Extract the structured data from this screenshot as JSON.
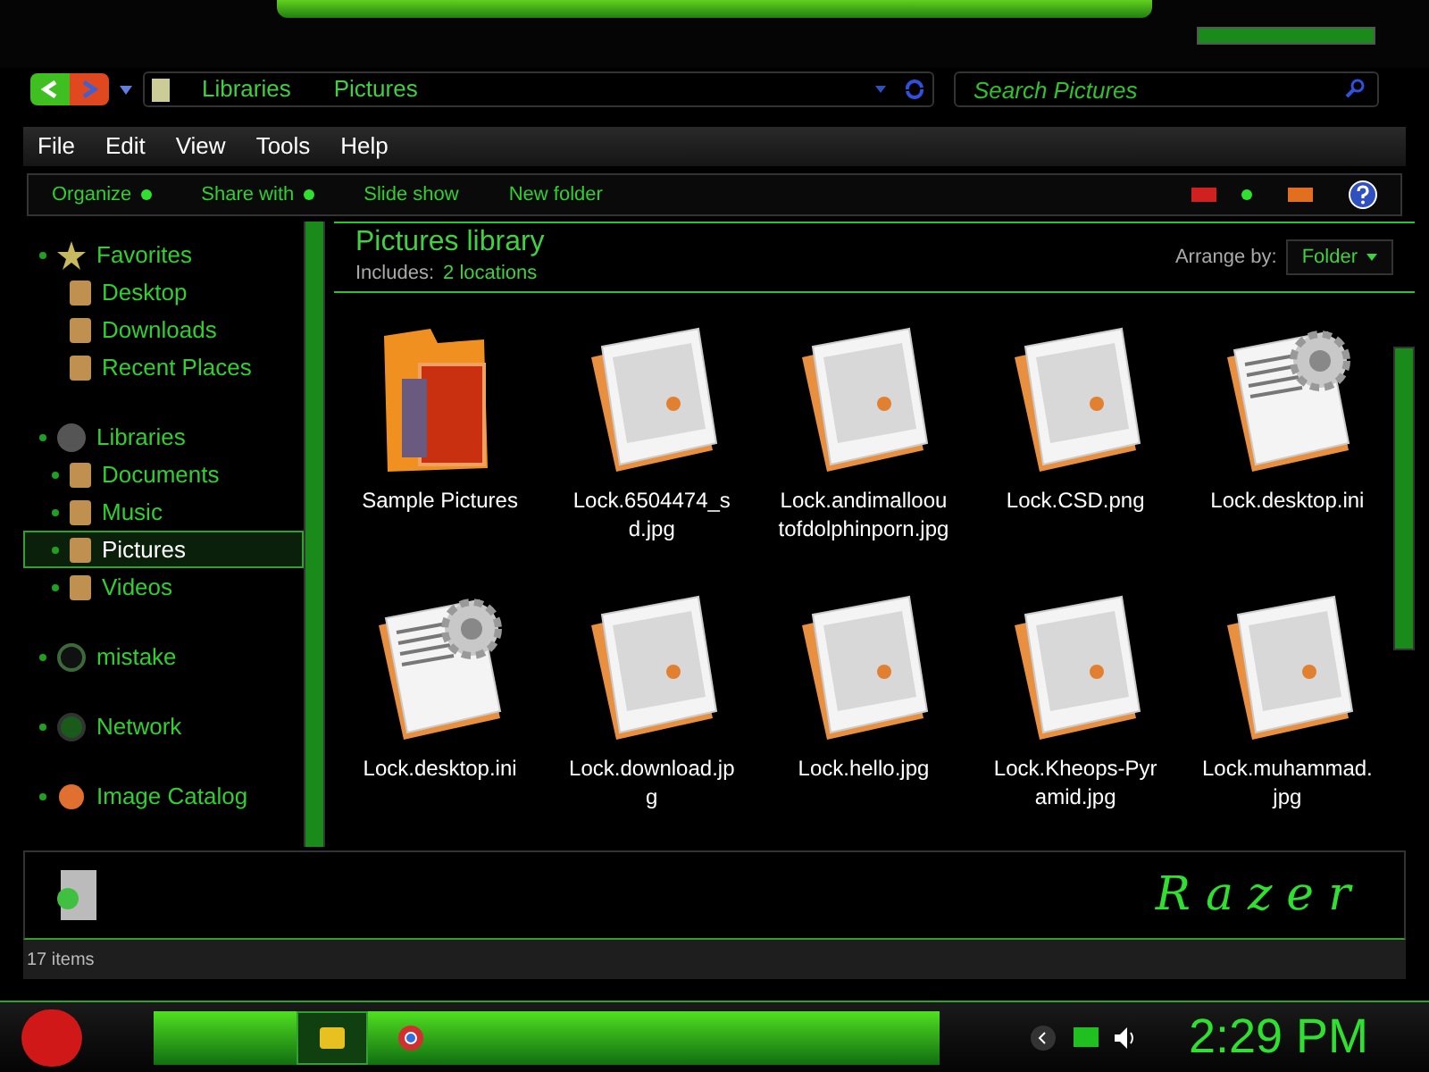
{
  "breadcrumb": [
    "Libraries",
    "Pictures"
  ],
  "search": {
    "placeholder": "Search Pictures"
  },
  "menu": [
    "File",
    "Edit",
    "View",
    "Tools",
    "Help"
  ],
  "commands": [
    {
      "label": "Organize",
      "dropdown": true
    },
    {
      "label": "Share with",
      "dropdown": true
    },
    {
      "label": "Slide show",
      "dropdown": false
    },
    {
      "label": "New folder",
      "dropdown": false
    }
  ],
  "sidebar": {
    "groups": [
      {
        "label": "Favorites",
        "kind": "star",
        "children": [
          {
            "label": "Desktop",
            "selected": false
          },
          {
            "label": "Downloads",
            "selected": false
          },
          {
            "label": "Recent Places",
            "selected": false
          }
        ]
      },
      {
        "label": "Libraries",
        "kind": "library",
        "children": [
          {
            "label": "Documents",
            "selected": false
          },
          {
            "label": "Music",
            "selected": false
          },
          {
            "label": "Pictures",
            "selected": true
          },
          {
            "label": "Videos",
            "selected": false
          }
        ]
      },
      {
        "label": "mistake",
        "kind": "user"
      },
      {
        "label": "Network",
        "kind": "network"
      },
      {
        "label": "Image Catalog",
        "kind": "catalog"
      }
    ]
  },
  "library": {
    "title": "Pictures library",
    "includes_label": "Includes:",
    "includes_link": "2 locations",
    "arrange_label": "Arrange by:",
    "arrange_value": "Folder"
  },
  "files": [
    {
      "name": "Sample Pictures",
      "kind": "folder"
    },
    {
      "name": "Lock.6504474_sd.jpg",
      "kind": "image"
    },
    {
      "name": "Lock.andimallooutofdolphinporn.jpg",
      "kind": "image"
    },
    {
      "name": "Lock.CSD.png",
      "kind": "image"
    },
    {
      "name": "Lock.desktop.ini",
      "kind": "settings"
    },
    {
      "name": "Lock.desktop.ini",
      "kind": "settings"
    },
    {
      "name": "Lock.download.jpg",
      "kind": "image"
    },
    {
      "name": "Lock.hello.jpg",
      "kind": "image"
    },
    {
      "name": "Lock.Kheops-Pyramid.jpg",
      "kind": "image"
    },
    {
      "name": "Lock.muhammad.jpg",
      "kind": "image"
    }
  ],
  "logo": "Razer",
  "status": "17 items",
  "clock": "2:29 PM"
}
